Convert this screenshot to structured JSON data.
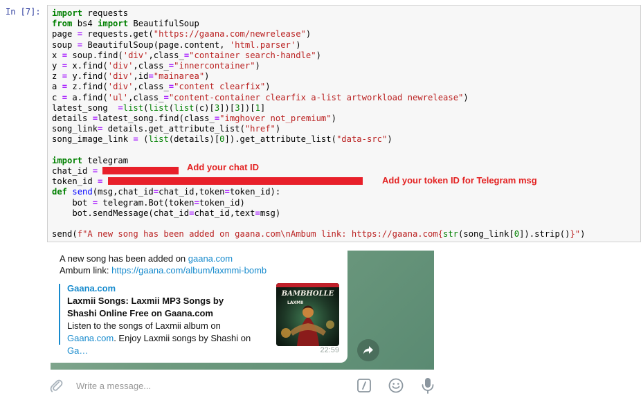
{
  "notebook": {
    "prompt": "In [7]:",
    "code": {
      "l1_import": "import",
      "l1_rest": " requests",
      "l2_from": "from",
      "l2_mid": " bs4 ",
      "l2_import": "import",
      "l2_rest": " BeautifulSoup",
      "l3_a": "page ",
      "l3_b": " requests.get(",
      "l3_str": "\"https://gaana.com/newrelease\"",
      "l3_c": ")",
      "l4_a": "soup ",
      "l4_b": " BeautifulSoup(page.content, ",
      "l4_str": "'html.parser'",
      "l4_c": ")",
      "l5_a": "x ",
      "l5_b": " soup.find(",
      "l5_s1": "'div'",
      "l5_c": ",class_",
      "l5_s2": "\"container search-handle\"",
      "l5_d": ")",
      "l6_a": "y ",
      "l6_b": " x.find(",
      "l6_s1": "'div'",
      "l6_c": ",class_",
      "l6_s2": "\"innercontainer\"",
      "l6_d": ")",
      "l7_a": "z ",
      "l7_b": " y.find(",
      "l7_s1": "'div'",
      "l7_c": ",id",
      "l7_s2": "\"mainarea\"",
      "l7_d": ")",
      "l8_a": "a ",
      "l8_b": " z.find(",
      "l8_s1": "'div'",
      "l8_c": ",class_",
      "l8_s2": "\"content clearfix\"",
      "l8_d": ")",
      "l9_a": "c ",
      "l9_b": " a.find(",
      "l9_s1": "'ul'",
      "l9_c": ",class_",
      "l9_s2": "\"content-container clearfix a-list artworkload newrelease\"",
      "l9_d": ")",
      "l10_a": "latest_song  ",
      "l10_list": "list",
      "l10_b": "(",
      "l10_c": "(",
      "l10_d": "(c)[",
      "l10_n1": "3",
      "l10_e": "])[",
      "l10_n2": "3",
      "l10_f": "])[",
      "l10_n3": "1",
      "l10_g": "]",
      "l11_a": "details ",
      "l11_b": "latest_song.find(class_",
      "l11_s": "\"imghover not_premium\"",
      "l11_c": ")",
      "l12_a": "song_link",
      "l12_b": " details.get_attribute_list(",
      "l12_s": "\"href\"",
      "l12_c": ")",
      "l13_a": "song_image_link ",
      "l13_b": " (",
      "l13_list": "list",
      "l13_c": "(details)[",
      "l13_n": "0",
      "l13_d": "]).get_attribute_list(",
      "l13_s": "\"data-src\"",
      "l13_e": ")",
      "l15_import": "import",
      "l15_rest": " telegram",
      "l16_a": "chat_id ",
      "l17_a": "token_id ",
      "l18_def": "def",
      "l18_fn": "send",
      "l18_a": "(msg,chat_id",
      "l18_b": "chat_id,token",
      "l18_c": "token_id):",
      "l19_a": "    bot ",
      "l19_b": " telegram.Bot(token",
      "l19_c": "token_id)",
      "l20_a": "    bot.sendMessage(chat_id",
      "l20_b": "chat_id,text",
      "l20_c": "msg)",
      "l22_a": "send(",
      "l22_s1": "f\"A new song has been added on gaana.com\\nAmbum link: https://gaana.com{",
      "l22_str": "str",
      "l22_mid": "(song_link[",
      "l22_n": "0",
      "l22_end": "]).strip()",
      "l22_s2": "}\"",
      "l22_close": ")"
    },
    "annotations": {
      "chat_id_note": "Add your chat ID",
      "token_note": "Add your token ID for Telegram msg"
    }
  },
  "telegram": {
    "message_line1_prefix": "A new song has been added on ",
    "message_line1_link": "gaana.com",
    "message_line2_prefix": "Ambum link: ",
    "message_line2_link": "https://gaana.com/album/laxmmi-bomb",
    "preview": {
      "site": "Gaana.com",
      "title": "Laxmii Songs: Laxmii MP3 Songs by Shashi Online Free on Gaana.com",
      "desc_prefix": "Listen to the songs of Laxmii album on ",
      "desc_link": "Gaana.com",
      "desc_middle": ". Enjoy Laxmii songs by Shashi on ",
      "desc_link2": "Ga…",
      "thumb_text_top": "BAMBHOLLE",
      "thumb_text_small": "LAXMII"
    },
    "timestamp": "22:59",
    "input_placeholder": "Write a message..."
  },
  "colors": {
    "annotation_red": "#e32222",
    "telegram_link": "#168acd",
    "keyword_green": "#008000",
    "string_red": "#ba2121"
  },
  "icons": [
    "paperclip-icon",
    "share-arrow-icon",
    "commands-icon",
    "emoji-icon",
    "microphone-icon"
  ]
}
